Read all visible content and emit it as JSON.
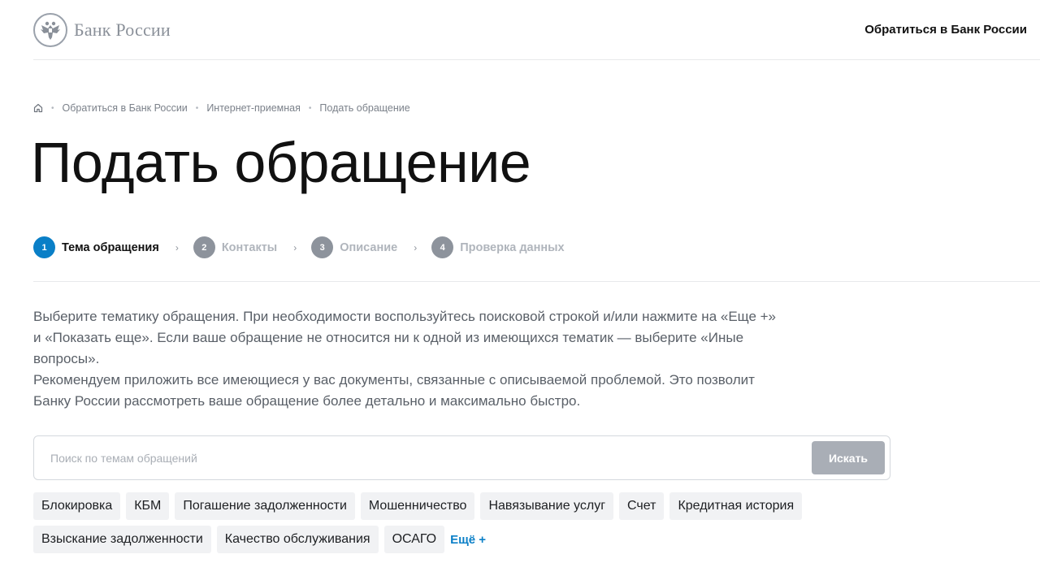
{
  "header": {
    "logo_text": "Банк России",
    "contact_link": "Обратиться в Банк России"
  },
  "breadcrumb": {
    "home_icon": "home-icon",
    "items": [
      "Обратиться в Банк России",
      "Интернет-приемная",
      "Подать обращение"
    ]
  },
  "page": {
    "title": "Подать обращение"
  },
  "steps": [
    {
      "num": "1",
      "label": "Тема обращения",
      "active": true
    },
    {
      "num": "2",
      "label": "Контакты",
      "active": false
    },
    {
      "num": "3",
      "label": "Описание",
      "active": false
    },
    {
      "num": "4",
      "label": "Проверка данных",
      "active": false
    }
  ],
  "description": {
    "paragraph1": "Выберите тематику обращения. При необходимости воспользуйтесь поисковой строкой и/или нажмите на «Еще +» и «Показать еще». Если ваше обращение не относится ни к одной из имеющихся тематик — выберите «Иные вопросы».",
    "paragraph2": "Рекомендуем приложить все имеющиеся у вас документы, связанные с описываемой проблемой. Это позволит Банку России рассмотреть ваше обращение более детально и максимально быстро."
  },
  "search": {
    "placeholder": "Поиск по темам обращений",
    "value": "",
    "button_label": "Искать"
  },
  "topics": {
    "row1": [
      "Блокировка",
      "КБМ",
      "Погашение задолженности",
      "Мошенничество",
      "Навязывание услуг",
      "Счет",
      "Кредитная история"
    ],
    "row2": [
      "Взыскание задолженности",
      "Качество обслуживания",
      "ОСАГО"
    ],
    "more_label": "Ещё +"
  },
  "colors": {
    "accent": "#0a7fc7",
    "step_inactive": "#8d939c",
    "chip_bg": "#f1f2f4",
    "button_disabled": "#a9aeb6"
  }
}
